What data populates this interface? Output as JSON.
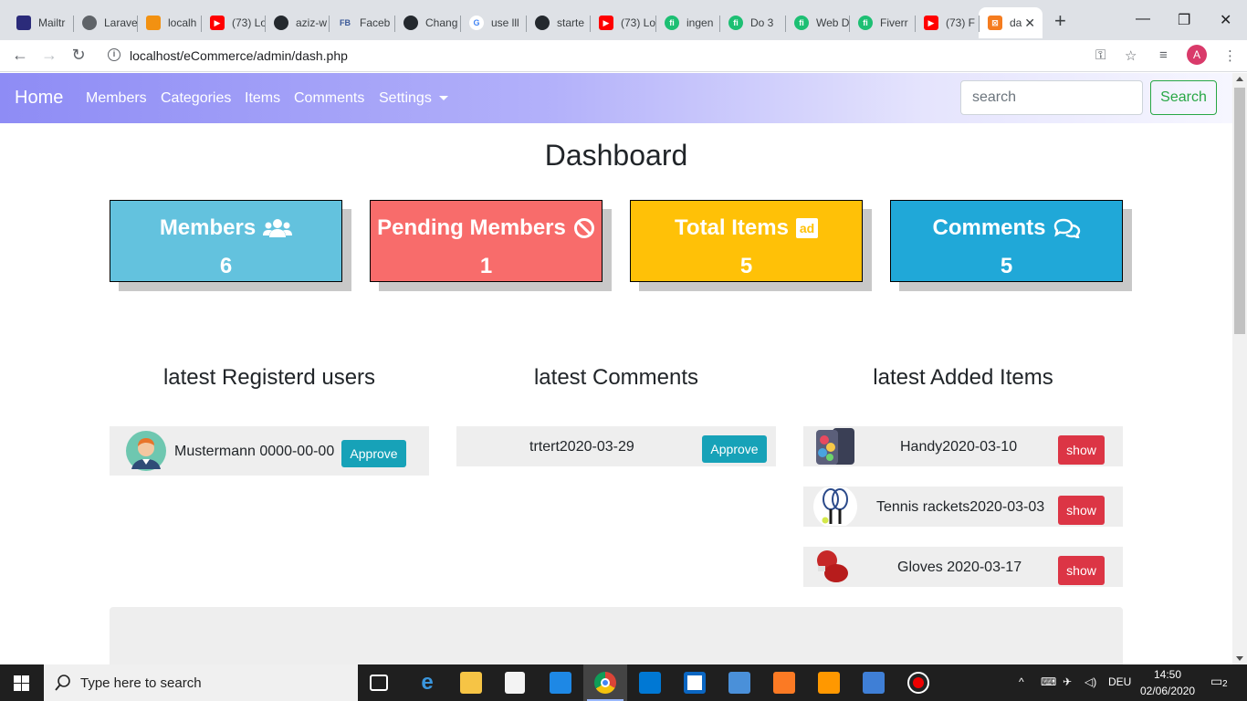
{
  "browser": {
    "tabs": [
      {
        "label": "Mailtr",
        "color": "#2b2b7a"
      },
      {
        "label": "Larave",
        "color": "#5f6368"
      },
      {
        "label": "localh",
        "color": "#f29111"
      },
      {
        "label": "(73) Lo",
        "color": "#ff0000"
      },
      {
        "label": "aziz-w",
        "color": "#24292e"
      },
      {
        "label": "Faceb",
        "color": "#3b5998"
      },
      {
        "label": "Chang",
        "color": "#24292e"
      },
      {
        "label": "use lll",
        "color": "#4285f4"
      },
      {
        "label": "starte",
        "color": "#24292e"
      },
      {
        "label": "(73) Lo",
        "color": "#ff0000"
      },
      {
        "label": "ingen",
        "color": "#1dbf73"
      },
      {
        "label": "Do 3 ",
        "color": "#1dbf73"
      },
      {
        "label": "Web D",
        "color": "#1dbf73"
      },
      {
        "label": "Fiverr",
        "color": "#1dbf73"
      },
      {
        "label": "(73) F",
        "color": "#ff0000"
      },
      {
        "label": "da",
        "color": "#f57c1f"
      }
    ],
    "url": "localhost/eCommerce/admin/dash.php",
    "profile_initial": "A"
  },
  "navbar": {
    "brand": "Home",
    "links": [
      "Members",
      "Categories",
      "Items",
      "Comments",
      "Settings"
    ],
    "search_placeholder": "search",
    "search_button": "Search"
  },
  "dashboard": {
    "title": "Dashboard",
    "stats": [
      {
        "label": "Members",
        "value": "6",
        "icon": "users-icon",
        "color": "#63c2de"
      },
      {
        "label": "Pending Members",
        "value": "1",
        "icon": "ban-icon",
        "color": "#f86c6b"
      },
      {
        "label": "Total Items",
        "value": "5",
        "icon": "ad-icon",
        "color": "#ffc107"
      },
      {
        "label": "Comments",
        "value": "5",
        "icon": "comments-icon",
        "color": "#20a8d8"
      }
    ]
  },
  "latest_users": {
    "title": "latest Registerd users",
    "rows": [
      {
        "text": "Mustermann 0000-00-00",
        "button": "Approve"
      }
    ]
  },
  "latest_comments": {
    "title": "latest Comments",
    "rows": [
      {
        "text": "trtert2020-03-29",
        "button": "Approve"
      }
    ]
  },
  "latest_items": {
    "title": "latest Added Items",
    "rows": [
      {
        "text": "Handy2020-03-10",
        "button": "show"
      },
      {
        "text": "Tennis rackets2020-03-03",
        "button": "show"
      },
      {
        "text": "Gloves 2020-03-17",
        "button": "show"
      }
    ]
  },
  "taskbar": {
    "search_placeholder": "Type here to search",
    "language": "DEU",
    "time": "14:50",
    "date": "02/06/2020",
    "notification_count": "2"
  }
}
